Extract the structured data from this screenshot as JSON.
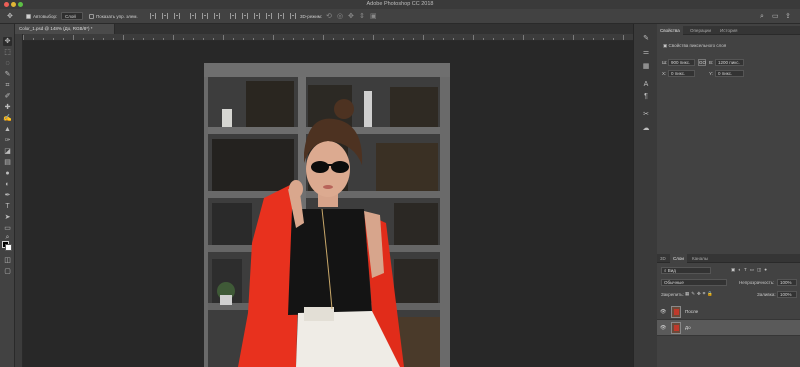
{
  "app_title": "Adobe Photoshop CC 2018",
  "options_bar": {
    "autoselect_label": "Автовыбор:",
    "autoselect_value": "Слой",
    "show_controls_label": "Показать упр. элем.",
    "mode3d_label": "3D-режим:"
  },
  "document": {
    "tab_label": "Color_1.psd @ 148% (До, RGB/8*) *"
  },
  "right_panel": {
    "tabs": [
      "Свойства",
      "Операции",
      "История"
    ],
    "section_title": "Свойства пиксельного слоя",
    "w_label": "Ш:",
    "w_value": "900 пикс.",
    "link_label": "GO",
    "h_label": "В:",
    "h_value": "1200 пикс.",
    "x_label": "X:",
    "x_value": "0 пикс.",
    "y_label": "Y:",
    "y_value": "0 пикс."
  },
  "layers_panel": {
    "tabs": [
      "3D",
      "Слои",
      "Каналы"
    ],
    "kind_filter": "Вид",
    "blend_mode": "Обычные",
    "opacity_label": "Непрозрачность:",
    "opacity_value": "100%",
    "lock_label": "Закрепить:",
    "fill_label": "Заливка:",
    "fill_value": "100%",
    "layers": [
      {
        "name": "После",
        "selected": false
      },
      {
        "name": "До",
        "selected": true
      }
    ]
  },
  "colors": {
    "accent_jacket": "#e8311e",
    "panel_bg": "#424242",
    "canvas_bg": "#282828"
  },
  "tools": [
    "move-icon",
    "marquee-icon",
    "lasso-icon",
    "quick-select-icon",
    "crop-icon",
    "eyedropper-icon",
    "healing-icon",
    "brush-icon",
    "stamp-icon",
    "history-brush-icon",
    "eraser-icon",
    "gradient-icon",
    "blur-icon",
    "dodge-icon",
    "pen-icon",
    "type-icon",
    "path-select-icon",
    "shape-icon",
    "hand-icon",
    "zoom-icon"
  ]
}
